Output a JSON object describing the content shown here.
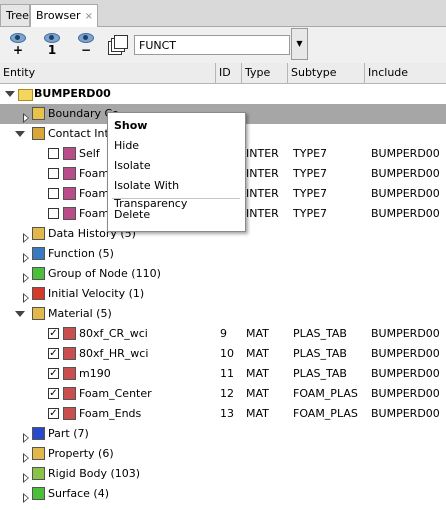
{
  "tabs": [
    {
      "label": "Tree"
    },
    {
      "label": "Browser",
      "close": "×"
    }
  ],
  "toolbar": {
    "buttons": [
      {
        "icon": "eye-show-icon",
        "symbol": "+"
      },
      {
        "icon": "eye-show-one-icon",
        "symbol": "1"
      },
      {
        "icon": "eye-hide-icon",
        "symbol": "−"
      }
    ],
    "layers_icon": "layers-icon",
    "search_value": "FUNCT",
    "dropdown_icon": "▼"
  },
  "columns": [
    "Entity",
    "ID",
    "Type",
    "Subtype",
    "Include"
  ],
  "tree": {
    "root": {
      "label": "BUMPERD00"
    },
    "rows": [
      {
        "label": "Boundary Co",
        "expanded": false,
        "selected": true,
        "icon": "boundary-condition-icon"
      },
      {
        "label": "Contact Inter",
        "expanded": true,
        "icon": "contact-icon"
      },
      {
        "label": "Self",
        "child": true,
        "checked": false,
        "type": "INTER",
        "subtype": "TYPE7",
        "include": "BUMPERD00",
        "icon": "interface-icon"
      },
      {
        "label": "Foam_",
        "child": true,
        "checked": false,
        "type": "INTER",
        "subtype": "TYPE7",
        "include": "BUMPERD00",
        "icon": "interface-icon"
      },
      {
        "label": "Foam_",
        "child": true,
        "checked": false,
        "type": "INTER",
        "subtype": "TYPE7",
        "include": "BUMPERD00",
        "icon": "interface-icon"
      },
      {
        "label": "Foam_",
        "child": true,
        "checked": false,
        "type": "INTER",
        "subtype": "TYPE7",
        "include": "BUMPERD00",
        "icon": "interface-icon"
      },
      {
        "label": "Data History",
        "count": "(5)",
        "expanded": false,
        "icon": "data-history-icon"
      },
      {
        "label": "Function",
        "count": "(5)",
        "expanded": false,
        "icon": "function-icon"
      },
      {
        "label": "Group of Node",
        "count": "(110)",
        "expanded": false,
        "icon": "group-of-node-icon"
      },
      {
        "label": "Initial Velocity",
        "count": "(1)",
        "expanded": false,
        "icon": "initial-velocity-icon"
      },
      {
        "label": "Material",
        "count": "(5)",
        "expanded": true,
        "icon": "material-icon"
      },
      {
        "label": "80xf_CR_wci",
        "child": true,
        "checked": true,
        "id": "9",
        "type": "MAT",
        "subtype": "PLAS_TAB",
        "include": "BUMPERD00",
        "icon": "material-item-icon"
      },
      {
        "label": "80xf_HR_wci",
        "child": true,
        "checked": true,
        "id": "10",
        "type": "MAT",
        "subtype": "PLAS_TAB",
        "include": "BUMPERD00",
        "icon": "material-item-icon"
      },
      {
        "label": "m190",
        "child": true,
        "checked": true,
        "id": "11",
        "type": "MAT",
        "subtype": "PLAS_TAB",
        "include": "BUMPERD00",
        "icon": "material-item-icon"
      },
      {
        "label": "Foam_Center",
        "child": true,
        "checked": true,
        "id": "12",
        "type": "MAT",
        "subtype": "FOAM_PLAS",
        "include": "BUMPERD00",
        "icon": "material-item-icon"
      },
      {
        "label": "Foam_Ends",
        "child": true,
        "checked": true,
        "id": "13",
        "type": "MAT",
        "subtype": "FOAM_PLAS",
        "include": "BUMPERD00",
        "icon": "material-item-icon"
      },
      {
        "label": "Part",
        "count": "(7)",
        "expanded": false,
        "icon": "part-icon"
      },
      {
        "label": "Property",
        "count": "(6)",
        "expanded": false,
        "icon": "property-icon"
      },
      {
        "label": "Rigid Body",
        "count": "(103)",
        "expanded": false,
        "icon": "rigid-body-icon"
      },
      {
        "label": "Surface",
        "count": "(4)",
        "expanded": false,
        "icon": "surface-icon"
      }
    ]
  },
  "context_menu": {
    "items": [
      {
        "label": "Show",
        "bold": true
      },
      {
        "label": "Hide"
      },
      {
        "label": "Isolate"
      },
      {
        "label": "Isolate With Transparency"
      },
      {
        "separator": true
      },
      {
        "label": "Delete"
      }
    ]
  }
}
